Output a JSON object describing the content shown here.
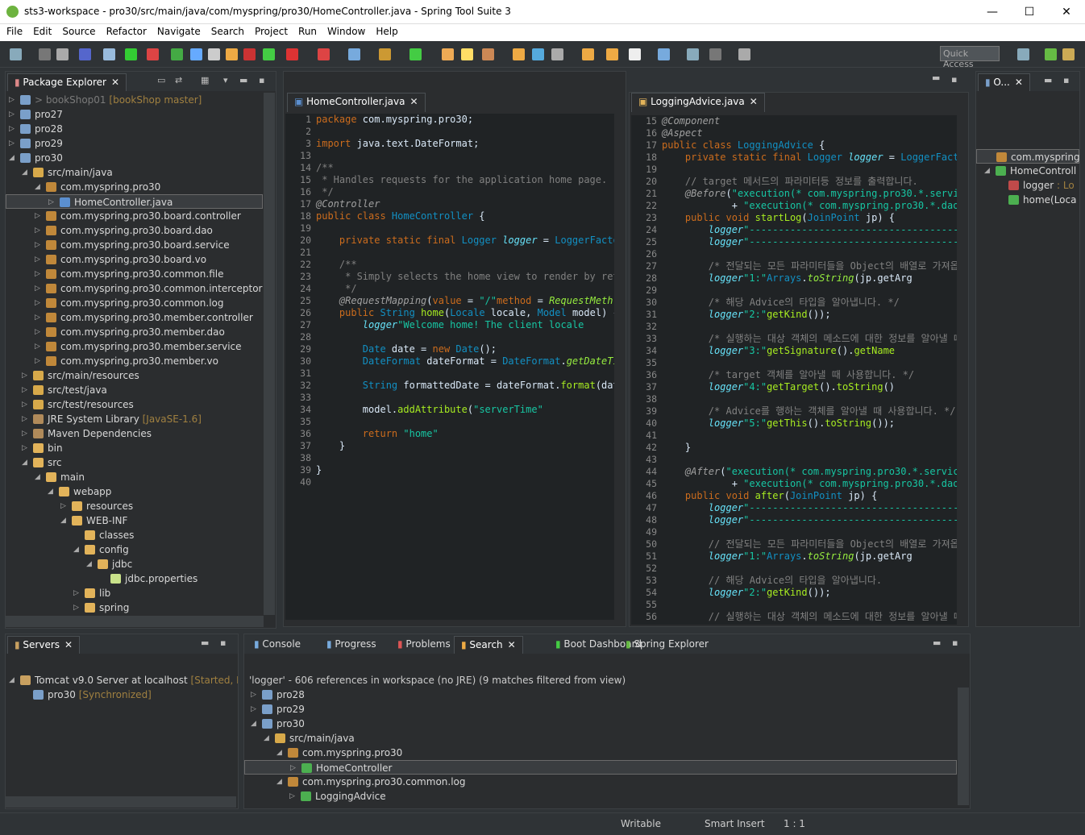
{
  "window": {
    "title": "sts3-workspace - pro30/src/main/java/com/myspring/pro30/HomeController.java - Spring Tool Suite 3",
    "min": "—",
    "max": "☐",
    "close": "✕"
  },
  "menu": [
    "File",
    "Edit",
    "Source",
    "Refactor",
    "Navigate",
    "Search",
    "Project",
    "Run",
    "Window",
    "Help"
  ],
  "quick_access": "Quick Access",
  "package_explorer": {
    "tab": "Package Explorer",
    "rows": [
      {
        "indent": 0,
        "tw": "▷",
        "ic": "#7a9fc9",
        "label": "> bookShop01",
        "dec": " [bookShop master]",
        "dim": true
      },
      {
        "indent": 0,
        "tw": "▷",
        "ic": "#7a9fc9",
        "label": "pro27"
      },
      {
        "indent": 0,
        "tw": "▷",
        "ic": "#7a9fc9",
        "label": "pro28"
      },
      {
        "indent": 0,
        "tw": "▷",
        "ic": "#7a9fc9",
        "label": "pro29"
      },
      {
        "indent": 0,
        "tw": "◢",
        "ic": "#7a9fc9",
        "label": "pro30"
      },
      {
        "indent": 1,
        "tw": "◢",
        "ic": "#d7a94a",
        "label": "src/main/java"
      },
      {
        "indent": 2,
        "tw": "◢",
        "ic": "#c0883a",
        "label": "com.myspring.pro30"
      },
      {
        "indent": 3,
        "tw": "▷",
        "ic": "#5b8fd0",
        "label": "HomeController.java",
        "sel": true
      },
      {
        "indent": 2,
        "tw": "▷",
        "ic": "#c0883a",
        "label": "com.myspring.pro30.board.controller"
      },
      {
        "indent": 2,
        "tw": "▷",
        "ic": "#c0883a",
        "label": "com.myspring.pro30.board.dao"
      },
      {
        "indent": 2,
        "tw": "▷",
        "ic": "#c0883a",
        "label": "com.myspring.pro30.board.service"
      },
      {
        "indent": 2,
        "tw": "▷",
        "ic": "#c0883a",
        "label": "com.myspring.pro30.board.vo"
      },
      {
        "indent": 2,
        "tw": "▷",
        "ic": "#c0883a",
        "label": "com.myspring.pro30.common.file"
      },
      {
        "indent": 2,
        "tw": "▷",
        "ic": "#c0883a",
        "label": "com.myspring.pro30.common.interceptor"
      },
      {
        "indent": 2,
        "tw": "▷",
        "ic": "#c0883a",
        "label": "com.myspring.pro30.common.log"
      },
      {
        "indent": 2,
        "tw": "▷",
        "ic": "#c0883a",
        "label": "com.myspring.pro30.member.controller"
      },
      {
        "indent": 2,
        "tw": "▷",
        "ic": "#c0883a",
        "label": "com.myspring.pro30.member.dao"
      },
      {
        "indent": 2,
        "tw": "▷",
        "ic": "#c0883a",
        "label": "com.myspring.pro30.member.service"
      },
      {
        "indent": 2,
        "tw": "▷",
        "ic": "#c0883a",
        "label": "com.myspring.pro30.member.vo"
      },
      {
        "indent": 1,
        "tw": "▷",
        "ic": "#d7a94a",
        "label": "src/main/resources"
      },
      {
        "indent": 1,
        "tw": "▷",
        "ic": "#d7a94a",
        "label": "src/test/java"
      },
      {
        "indent": 1,
        "tw": "▷",
        "ic": "#d7a94a",
        "label": "src/test/resources"
      },
      {
        "indent": 1,
        "tw": "▷",
        "ic": "#b08a5a",
        "label": "JRE System Library",
        "dec": " [JavaSE-1.6]"
      },
      {
        "indent": 1,
        "tw": "▷",
        "ic": "#b08a5a",
        "label": "Maven Dependencies"
      },
      {
        "indent": 1,
        "tw": "▷",
        "ic": "#e2b35a",
        "label": "bin"
      },
      {
        "indent": 1,
        "tw": "◢",
        "ic": "#e2b35a",
        "label": "src"
      },
      {
        "indent": 2,
        "tw": "◢",
        "ic": "#e2b35a",
        "label": "main"
      },
      {
        "indent": 3,
        "tw": "◢",
        "ic": "#e2b35a",
        "label": "webapp"
      },
      {
        "indent": 4,
        "tw": "▷",
        "ic": "#e2b35a",
        "label": "resources"
      },
      {
        "indent": 4,
        "tw": "◢",
        "ic": "#e2b35a",
        "label": "WEB-INF"
      },
      {
        "indent": 5,
        "tw": "",
        "ic": "#e2b35a",
        "label": "classes"
      },
      {
        "indent": 5,
        "tw": "◢",
        "ic": "#e2b35a",
        "label": "config"
      },
      {
        "indent": 6,
        "tw": "◢",
        "ic": "#e2b35a",
        "label": "jdbc"
      },
      {
        "indent": 7,
        "tw": "",
        "ic": "#c9e28a",
        "label": "jdbc.properties"
      },
      {
        "indent": 5,
        "tw": "▷",
        "ic": "#e2b35a",
        "label": "lib"
      },
      {
        "indent": 5,
        "tw": "▷",
        "ic": "#e2b35a",
        "label": "spring"
      }
    ]
  },
  "editor1": {
    "tab": "HomeController.java",
    "start": 1,
    "lines": [
      [
        [
          "kw",
          "package "
        ],
        [
          "",
          "com.myspring.pro30;"
        ]
      ],
      [],
      [
        [
          "kw",
          "import "
        ],
        [
          "",
          "java.text.DateFormat;"
        ]
      ],
      [],
      [
        [
          "cm",
          "/**"
        ]
      ],
      [
        [
          "cm",
          " * Handles requests for the application home page."
        ]
      ],
      [
        [
          "cm",
          " */"
        ]
      ],
      [
        [
          "an",
          "@Controller"
        ]
      ],
      [
        [
          "kw",
          "public class "
        ],
        [
          "ty",
          "HomeController"
        ],
        [
          "",
          " {"
        ]
      ],
      [],
      [
        [
          "kw",
          "    private static final "
        ],
        [
          "ty",
          "Logger"
        ],
        [
          "fd",
          " logger"
        ],
        [
          "",
          " = "
        ],
        [
          "ty",
          "LoggerFactor"
        ]
      ],
      [],
      [
        [
          "cm",
          "    /**"
        ]
      ],
      [
        [
          "cm",
          "     * Simply selects the home view to render by retu"
        ]
      ],
      [
        [
          "cm",
          "     */"
        ]
      ],
      [
        [
          "an",
          "    @RequestMapping"
        ],
        [
          "",
          "("
        ],
        [
          "kw",
          "value"
        ],
        [
          "",
          " = "
        ],
        [
          "st",
          "\"/\""
        ],
        [
          ",  "
        ],
        [
          "kw",
          "method"
        ],
        [
          "",
          " = "
        ],
        [
          "it",
          "RequestMeth"
        ]
      ],
      [
        [
          "kw",
          "    public "
        ],
        [
          "ty",
          "String"
        ],
        [
          "mt",
          " home"
        ],
        [
          "",
          "("
        ],
        [
          "ty",
          "Locale"
        ],
        [
          "",
          " locale, "
        ],
        [
          "ty",
          "Model"
        ],
        [
          "",
          " model) {"
        ]
      ],
      [
        [
          "fd",
          "        logger"
        ],
        [
          ".info("
        ],
        [
          "st",
          "\"Welcome home! The client locale"
        ]
      ],
      [],
      [
        [
          "ty",
          "        Date"
        ],
        [
          "",
          " date = "
        ],
        [
          "kw",
          "new "
        ],
        [
          "ty",
          "Date"
        ],
        [
          "",
          "();"
        ]
      ],
      [
        [
          "ty",
          "        DateFormat"
        ],
        [
          "",
          " dateFormat = "
        ],
        [
          "ty",
          "DateFormat"
        ],
        [
          "",
          "."
        ],
        [
          "it",
          "getDateTim"
        ]
      ],
      [],
      [
        [
          "ty",
          "        String"
        ],
        [
          "",
          " formattedDate = dateFormat."
        ],
        [
          "mt",
          "format"
        ],
        [
          "",
          "(date"
        ]
      ],
      [],
      [
        [
          "",
          "        model."
        ],
        [
          "mt",
          "addAttribute"
        ],
        [
          "",
          "("
        ],
        [
          "st",
          "\"serverTime\""
        ],
        [
          ", formattedDat"
        ]
      ],
      [],
      [
        [
          "kw",
          "        return "
        ],
        [
          "st",
          "\"home\""
        ],
        [
          ";"
        ]
      ],
      [
        [
          "",
          "    }"
        ]
      ],
      [],
      [
        [
          "",
          "}"
        ]
      ],
      []
    ],
    "linenums": [
      1,
      2,
      3,
      13,
      14,
      15,
      16,
      17,
      18,
      19,
      20,
      21,
      22,
      23,
      24,
      25,
      26,
      27,
      28,
      29,
      30,
      31,
      32,
      33,
      34,
      35,
      36,
      37,
      38,
      39,
      40
    ]
  },
  "editor2": {
    "tab": "LoggingAdvice.java",
    "linenums": [
      15,
      16,
      17,
      18,
      19,
      20,
      21,
      22,
      23,
      24,
      25,
      26,
      27,
      28,
      29,
      30,
      31,
      32,
      33,
      34,
      35,
      36,
      37,
      38,
      39,
      40,
      41,
      42,
      43,
      44,
      45,
      46,
      47,
      48,
      49,
      50,
      51,
      52,
      53,
      54,
      55,
      56
    ],
    "lines": [
      [
        [
          "an",
          "@Component"
        ]
      ],
      [
        [
          "an",
          "@Aspect"
        ]
      ],
      [
        [
          "kw",
          "public class "
        ],
        [
          "ty",
          "LoggingAdvice"
        ],
        [
          "",
          " {"
        ]
      ],
      [
        [
          "kw",
          "    private static final "
        ],
        [
          "ty",
          "Logger"
        ],
        [
          "fd",
          " logger"
        ],
        [
          "",
          " = "
        ],
        [
          "ty",
          "LoggerFacto"
        ]
      ],
      [],
      [
        [
          "cm",
          "    // target 메서드의 파라미터등 정보를 출력합니다."
        ]
      ],
      [
        [
          "an",
          "    @Before"
        ],
        [
          "",
          "("
        ],
        [
          "st",
          "\"execution(* com.myspring.pro30.*.servic"
        ]
      ],
      [
        [
          "",
          "            + "
        ],
        [
          "st",
          "\"execution(* com.myspring.pro30.*.dao."
        ]
      ],
      [
        [
          "kw",
          "    public void "
        ],
        [
          "mt",
          "startLog"
        ],
        [
          "",
          "("
        ],
        [
          "ty",
          "JoinPoint"
        ],
        [
          "",
          " jp) {"
        ]
      ],
      [
        [
          "fd",
          "        logger"
        ],
        [
          ".info("
        ],
        [
          "st",
          "\"-------------------------------------"
        ]
      ],
      [
        [
          "fd",
          "        logger"
        ],
        [
          ".info("
        ],
        [
          "st",
          "\"-------------------------------------"
        ]
      ],
      [],
      [
        [
          "cm",
          "        /* 전달되는 모든 파라미터들을 Object의 배열로 가져옵니다."
        ]
      ],
      [
        [
          "fd",
          "        logger"
        ],
        [
          ".info("
        ],
        [
          "st",
          "\"1:\""
        ],
        [
          " + "
        ],
        [
          "ty",
          "Arrays"
        ],
        [
          "",
          "."
        ],
        [
          "it",
          "toString"
        ],
        [
          "",
          "(jp.getArg"
        ]
      ],
      [],
      [
        [
          "cm",
          "        /* 해당 Advice의 타입을 알아냅니다. */"
        ]
      ],
      [
        [
          "fd",
          "        logger"
        ],
        [
          ".info("
        ],
        [
          "st",
          "\"2:\""
        ],
        [
          " + jp."
        ],
        [
          "mt",
          "getKind"
        ],
        [
          "",
          "());"
        ]
      ],
      [],
      [
        [
          "cm",
          "        /* 실행하는 대상 객체의 메소드에 대한 정보를 알아낼 때 사용한"
        ]
      ],
      [
        [
          "fd",
          "        logger"
        ],
        [
          ".info("
        ],
        [
          "st",
          "\"3:\""
        ],
        [
          " + jp."
        ],
        [
          "mt",
          "getSignature"
        ],
        [
          "",
          "()."
        ],
        [
          "mt",
          "getName"
        ]
      ],
      [],
      [
        [
          "cm",
          "        /* target 객체를 알아낼 때 사용합니다. */"
        ]
      ],
      [
        [
          "fd",
          "        logger"
        ],
        [
          ".info("
        ],
        [
          "st",
          "\"4:\""
        ],
        [
          " + jp."
        ],
        [
          "mt",
          "getTarget"
        ],
        [
          "",
          "()."
        ],
        [
          "mt",
          "toString"
        ],
        [
          "",
          "()"
        ]
      ],
      [],
      [
        [
          "cm",
          "        /* Advice를 행하는 객체를 알아낼 때 사용합니다. */"
        ]
      ],
      [
        [
          "fd",
          "        logger"
        ],
        [
          ".info("
        ],
        [
          "st",
          "\"5:\""
        ],
        [
          " + jp."
        ],
        [
          "mt",
          "getThis"
        ],
        [
          "",
          "()."
        ],
        [
          "mt",
          "toString"
        ],
        [
          "",
          "());"
        ]
      ],
      [],
      [
        [
          "",
          "    }"
        ]
      ],
      [],
      [
        [
          "an",
          "    @After"
        ],
        [
          "",
          "("
        ],
        [
          "st",
          "\"execution(* com.myspring.pro30.*.service"
        ]
      ],
      [
        [
          "",
          "            + "
        ],
        [
          "st",
          "\"execution(* com.myspring.pro30.*.dao."
        ]
      ],
      [
        [
          "kw",
          "    public void "
        ],
        [
          "mt",
          "after"
        ],
        [
          "",
          "("
        ],
        [
          "ty",
          "JoinPoint"
        ],
        [
          "",
          " jp) {"
        ]
      ],
      [
        [
          "fd",
          "        logger"
        ],
        [
          ".info("
        ],
        [
          "st",
          "\"-------------------------------------"
        ]
      ],
      [
        [
          "fd",
          "        logger"
        ],
        [
          ".info("
        ],
        [
          "st",
          "\"-------------------------------------"
        ]
      ],
      [],
      [
        [
          "cm",
          "        // 전달되는 모든 파라미터들을 Object의 배열로 가져옵니다."
        ]
      ],
      [
        [
          "fd",
          "        logger"
        ],
        [
          ".info("
        ],
        [
          "st",
          "\"1:\""
        ],
        [
          " + "
        ],
        [
          "ty",
          "Arrays"
        ],
        [
          "",
          "."
        ],
        [
          "it",
          "toString"
        ],
        [
          "",
          "(jp.getArg"
        ]
      ],
      [],
      [
        [
          "cm",
          "        // 해당 Advice의 타입을 알아냅니다."
        ]
      ],
      [
        [
          "fd",
          "        logger"
        ],
        [
          ".info("
        ],
        [
          "st",
          "\"2:\""
        ],
        [
          " + jp."
        ],
        [
          "mt",
          "getKind"
        ],
        [
          "",
          "());"
        ]
      ],
      [],
      [
        [
          "cm",
          "        // 실행하는 대상 객체의 메소드에 대한 정보를 알아낼 때 사용한"
        ]
      ]
    ]
  },
  "outline": {
    "tab": "O...",
    "rows": [
      {
        "indent": 0,
        "tw": "",
        "ic": "#c0883a",
        "label": "com.myspring",
        "sel": true
      },
      {
        "indent": 0,
        "tw": "◢",
        "ic": "#4caf50",
        "label": "HomeControll"
      },
      {
        "indent": 1,
        "tw": "",
        "ic": "#c04a4a",
        "label": "logger",
        "dec": " : Lo"
      },
      {
        "indent": 1,
        "tw": "",
        "ic": "#4caf50",
        "label": "home(Loca"
      }
    ]
  },
  "servers": {
    "tab": "Servers",
    "rows": [
      {
        "indent": 0,
        "tw": "◢",
        "ic": "#c8a060",
        "label": "Tomcat v9.0 Server at localhost",
        "dec": "  [Started, Res"
      },
      {
        "indent": 1,
        "tw": "",
        "ic": "#7a9fc9",
        "label": "pro30",
        "dec": "  [Synchronized]"
      }
    ]
  },
  "bottom_tabs": [
    "Console",
    "Progress",
    "Problems",
    "Search",
    "Boot Dashboard",
    "Spring Explorer"
  ],
  "search": {
    "summary": "'logger' - 606 references in workspace (no JRE) (9 matches filtered from view)",
    "rows": [
      {
        "indent": 0,
        "tw": "▷",
        "ic": "#7a9fc9",
        "label": "pro28"
      },
      {
        "indent": 0,
        "tw": "▷",
        "ic": "#7a9fc9",
        "label": "pro29"
      },
      {
        "indent": 0,
        "tw": "◢",
        "ic": "#7a9fc9",
        "label": "pro30"
      },
      {
        "indent": 1,
        "tw": "◢",
        "ic": "#d7a94a",
        "label": "src/main/java"
      },
      {
        "indent": 2,
        "tw": "◢",
        "ic": "#c0883a",
        "label": "com.myspring.pro30"
      },
      {
        "indent": 3,
        "tw": "▷",
        "ic": "#4caf50",
        "label": "HomeController",
        "sel": true
      },
      {
        "indent": 2,
        "tw": "◢",
        "ic": "#c0883a",
        "label": "com.myspring.pro30.common.log"
      },
      {
        "indent": 3,
        "tw": "▷",
        "ic": "#4caf50",
        "label": "LoggingAdvice"
      }
    ]
  },
  "status": {
    "writable": "Writable",
    "insert": "Smart Insert",
    "pos": "1 : 1"
  },
  "colors": {
    "bg": "#2f3336",
    "editor_bg": "#202325",
    "keyword": "#cc6c1d",
    "type": "#1290c3",
    "string": "#17c6a3",
    "comment": "#808080"
  }
}
